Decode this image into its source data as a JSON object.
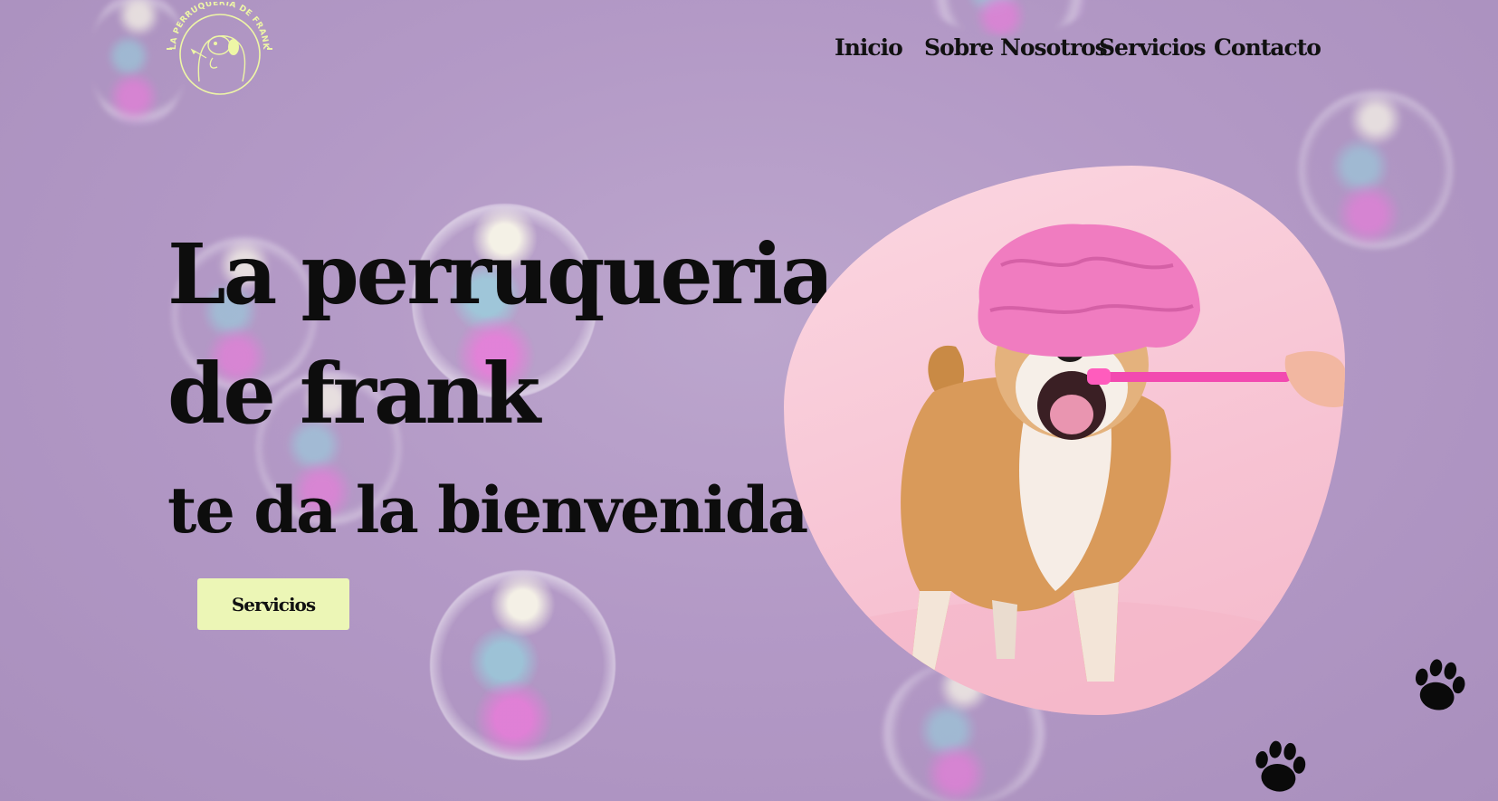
{
  "logo": {
    "text": "LA PERRUQUERIA DE FRANK",
    "color": "#eef6a6"
  },
  "nav": {
    "items": [
      {
        "label": "Inicio"
      },
      {
        "label": "Sobre Nosotros"
      },
      {
        "label": "Servicios"
      },
      {
        "label": "Contacto"
      }
    ]
  },
  "hero": {
    "title_line1": "La perruqueria",
    "title_line2": "de frank",
    "subtitle": "te da la bienvenida.",
    "cta_label": "Servicios",
    "cta_color": "#ecf6b6"
  },
  "image": {
    "alt_icon": "dog-with-shower-cap-image"
  },
  "decorations": {
    "paw_icon": "paw-icon",
    "bubble_icon": "soap-bubble"
  },
  "colors": {
    "background": "#b399c6",
    "text": "#0d0d0d",
    "accent": "#ecf6b6",
    "hero_image_bg": "#f7c3d3"
  }
}
